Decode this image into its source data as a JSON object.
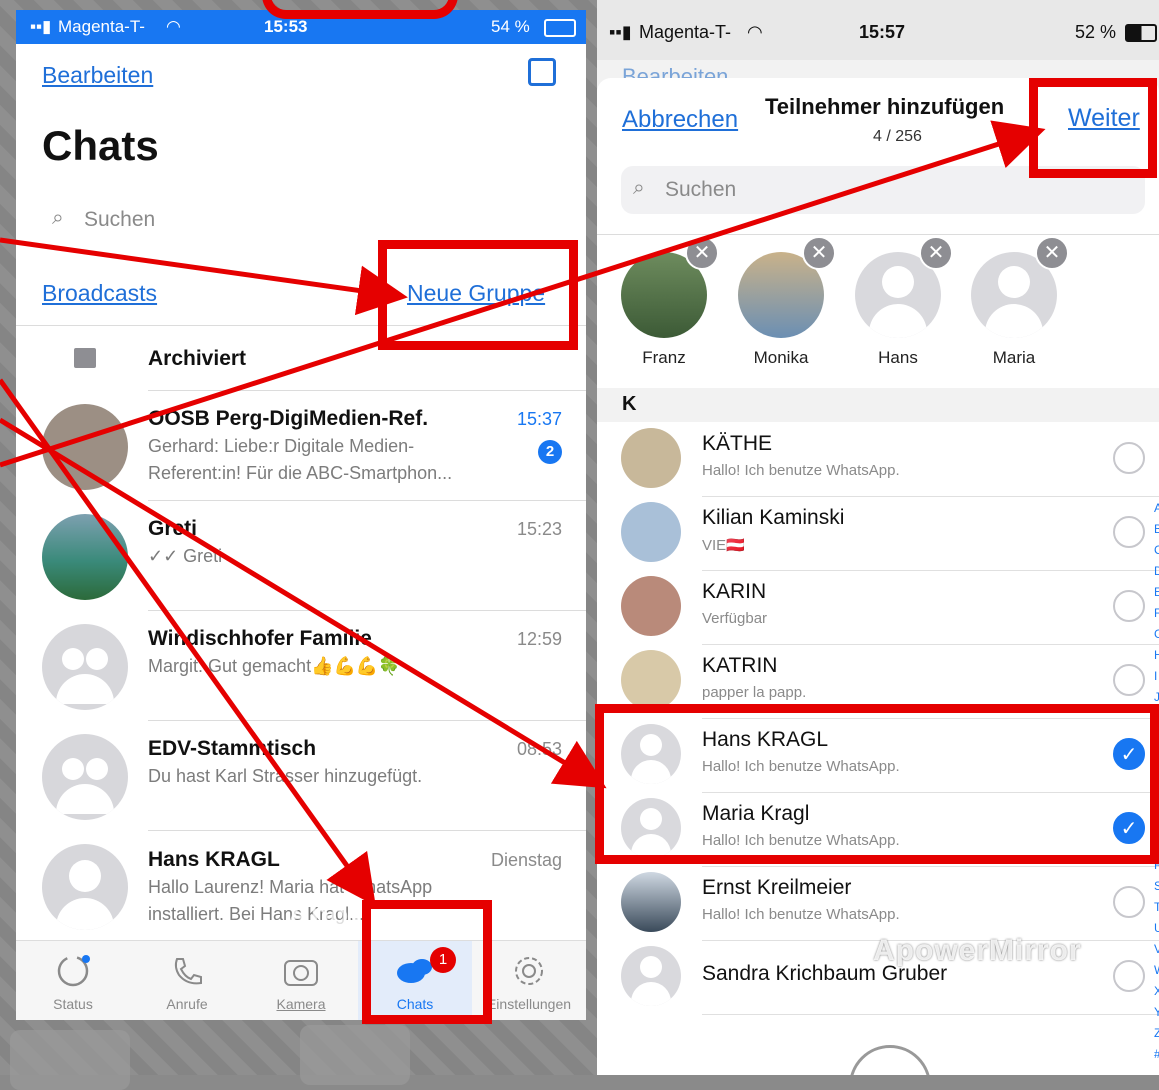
{
  "left": {
    "status": {
      "carrier": "Magenta-T-",
      "time": "15:53",
      "battery": "54 %"
    },
    "edit_label": "Bearbeiten",
    "title": "Chats",
    "search_placeholder": "Suchen",
    "broadcasts_label": "Broadcasts",
    "new_group_label": "Neue Gruppe",
    "archived_label": "Archiviert",
    "chats": [
      {
        "name": "OOSB Perg-DigiMedien-Ref.",
        "line1": "Gerhard: Liebe:r Digitale Medien-",
        "line2": "Referent:in! Für die ABC-Smartphon...",
        "time": "15:37",
        "unread": "2"
      },
      {
        "name": "Greti",
        "line1": "✓✓ Greti",
        "line2": "",
        "time": "15:23"
      },
      {
        "name": "Windischhofer Familie",
        "line1": "Margit: Gut gemacht👍💪💪🍀",
        "line2": "",
        "time": "12:59"
      },
      {
        "name": "EDV-Stammtisch",
        "line1": "Du hast Karl Strasser hinzugefügt.",
        "line2": "",
        "time": "08:53"
      },
      {
        "name": "Hans KRAGL",
        "line1": "Hallo Laurenz! Maria hat WhatsApp",
        "line2": "installiert. Bei Hans Kragl...",
        "time": "Dienstag"
      }
    ],
    "tabs": [
      {
        "label": "Status",
        "icon": "status-icon"
      },
      {
        "label": "Anrufe",
        "icon": "phone-icon"
      },
      {
        "label": "Kamera",
        "icon": "camera-icon"
      },
      {
        "label": "Chats",
        "icon": "chat-bubbles-icon",
        "badge": "1"
      },
      {
        "label": "Einstellungen",
        "icon": "gear-icon"
      }
    ],
    "watermark": "ApowerMirror"
  },
  "right": {
    "status": {
      "carrier": "Magenta-T-",
      "time": "15:57",
      "battery": "52 %"
    },
    "behind_text": "Bearbeiten",
    "cancel_label": "Abbrechen",
    "title": "Teilnehmer hinzufügen",
    "count": "4 / 256",
    "next_label": "Weiter",
    "search_placeholder": "Suchen",
    "selected": [
      "Franz",
      "Monika",
      "Hans",
      "Maria"
    ],
    "section": "K",
    "contacts": [
      {
        "name": "KÄTHE",
        "status": "Hallo! Ich benutze WhatsApp.",
        "checked": false
      },
      {
        "name": "Kilian Kaminski",
        "status": "VIE🇦🇹",
        "checked": false
      },
      {
        "name": "KARIN",
        "status": "Verfügbar",
        "checked": false
      },
      {
        "name": "KATRIN",
        "status": "papper la papp.",
        "checked": false
      },
      {
        "name": "Hans KRAGL",
        "status": "Hallo! Ich benutze WhatsApp.",
        "checked": true
      },
      {
        "name": "Maria  Kragl",
        "status": "Hallo! Ich benutze WhatsApp.",
        "checked": true
      },
      {
        "name": "Ernst Kreilmeier",
        "status": "Hallo! Ich benutze WhatsApp.",
        "checked": false
      },
      {
        "name": "Sandra Krichbaum Gruber",
        "status": "",
        "checked": false
      }
    ],
    "watermark": "ApowerMirror"
  },
  "colors": {
    "accent": "#1877f2",
    "annotation": "#e50000"
  }
}
